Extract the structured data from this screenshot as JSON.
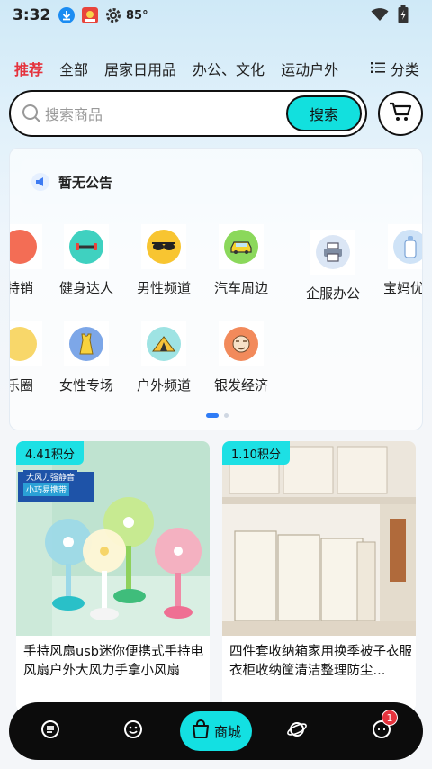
{
  "status_bar": {
    "time": "3:32",
    "temperature": "85°",
    "icons": [
      "download-icon",
      "app-notification-icon",
      "settings-gear-icon",
      "wifi-icon",
      "battery-charging-icon"
    ]
  },
  "tabs": [
    {
      "label": "推荐",
      "active": true
    },
    {
      "label": "全部"
    },
    {
      "label": "居家日用品"
    },
    {
      "label": "办公、文化"
    },
    {
      "label": "运动户外"
    }
  ],
  "category_button": "分类",
  "search": {
    "placeholder": "搜索商品",
    "button": "搜索"
  },
  "notice": {
    "text": "暂无公告"
  },
  "categories_row1": [
    {
      "label": "特销",
      "icon": "partial-icon",
      "color": "#f36d55"
    },
    {
      "label": "健身达人",
      "icon": "dumbbell-icon",
      "color": "#3fd1c0"
    },
    {
      "label": "男性频道",
      "icon": "sunglasses-icon",
      "color": "#f8c531"
    },
    {
      "label": "汽车周边",
      "icon": "car-icon",
      "color": "#8bd85b"
    },
    {
      "label": "企服办公",
      "icon": "printer-icon",
      "color": "#dbe6f5"
    },
    {
      "label": "宝妈优选",
      "icon": "baby-bottle-icon",
      "color": "#cfe3f7"
    }
  ],
  "categories_row2": [
    {
      "label": "乐圈",
      "icon": "partial-icon",
      "color": "#f8d76a"
    },
    {
      "label": "女性专场",
      "icon": "tank-top-icon",
      "color": "#7da7e8"
    },
    {
      "label": "户外频道",
      "icon": "tent-icon",
      "color": "#9ee3e3"
    },
    {
      "label": "银发经济",
      "icon": "elder-face-icon",
      "color": "#f28a5b"
    }
  ],
  "pager": {
    "pages": 2,
    "current": 1
  },
  "products": [
    {
      "badge": "4.41积分",
      "title": "手持风扇usb迷你便携式手持电风扇户外大风力手拿小风扇",
      "image_text": [
        "大风力强静音",
        "小巧易携带"
      ]
    },
    {
      "badge": "1.10积分",
      "title": "四件套收纳箱家用换季被子衣服衣柜收纳筐清洁整理防尘..."
    }
  ],
  "bottom_nav": [
    {
      "name": "list-icon"
    },
    {
      "name": "smile-icon"
    },
    {
      "name": "shop-bag-icon",
      "label": "商城",
      "active": true
    },
    {
      "name": "planet-icon"
    },
    {
      "name": "message-icon",
      "badge": "1"
    }
  ],
  "colors": {
    "accent": "#13e0e2",
    "active_tab": "#e5333d",
    "nav_bg": "#0c0c0c"
  }
}
